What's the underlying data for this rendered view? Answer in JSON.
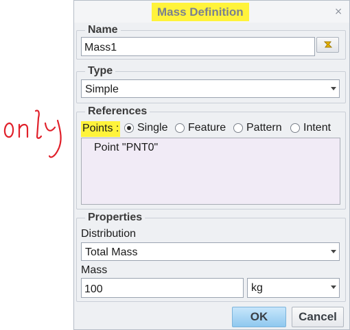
{
  "dialog": {
    "title": "Mass Definition",
    "close_symbol": "×"
  },
  "annotation": {
    "text": "only"
  },
  "name_section": {
    "legend": "Name",
    "value": "Mass1",
    "icon": "refresh-icon"
  },
  "type_section": {
    "legend": "Type",
    "selected": "Simple"
  },
  "references_section": {
    "legend": "References",
    "points_label": "Points :",
    "options": [
      {
        "label": "Single",
        "checked": true
      },
      {
        "label": "Feature",
        "checked": false
      },
      {
        "label": "Pattern",
        "checked": false
      },
      {
        "label": "Intent",
        "checked": false
      }
    ],
    "items": [
      "Point \"PNT0\""
    ]
  },
  "properties_section": {
    "legend": "Properties",
    "distribution_label": "Distribution",
    "distribution_selected": "Total Mass",
    "mass_label": "Mass",
    "mass_value": "100",
    "unit_selected": "kg"
  },
  "buttons": {
    "ok_label": "OK",
    "cancel_label": "Cancel"
  },
  "colors": {
    "highlight": "#fff33b",
    "ok_button": "#a9d6f5",
    "annotation_ink": "#e0202a"
  }
}
